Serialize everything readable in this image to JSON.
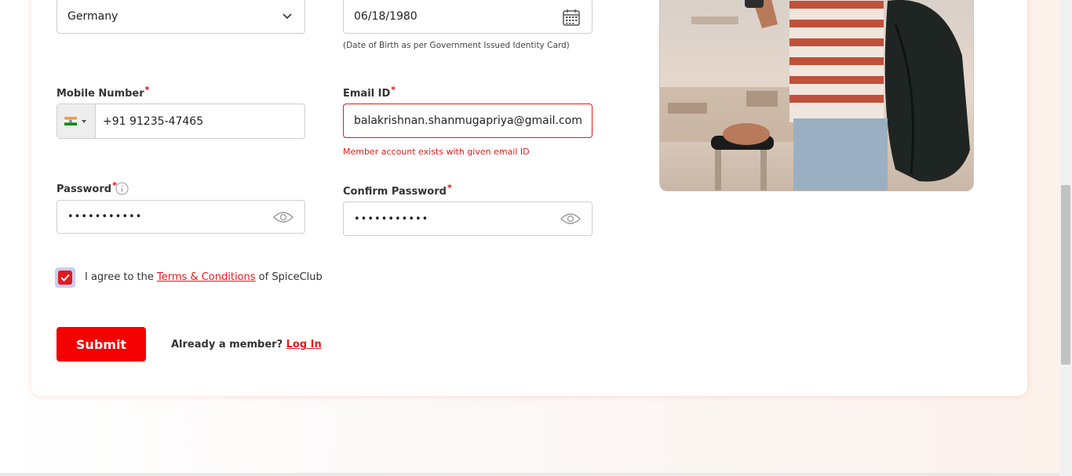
{
  "form": {
    "country": {
      "value": "Germany"
    },
    "dob": {
      "value": "06/18/1980",
      "helper": "(Date of Birth as per Government Issued Identity Card)"
    },
    "mobile": {
      "label": "Mobile Number",
      "required_mark": "*",
      "country_code_flag": "india-flag-icon",
      "value": "+91 91235-47465"
    },
    "email": {
      "label": "Email ID",
      "required_mark": "*",
      "value": "balakrishnan.shanmugapriya@gmail.com",
      "error": "Member account exists with given email ID"
    },
    "password": {
      "label": "Password",
      "required_mark": "*",
      "value": "•••••••••••"
    },
    "confirm_password": {
      "label": "Confirm Password",
      "required_mark": "*",
      "value": "•••••••••••"
    },
    "terms": {
      "checked": true,
      "prefix": "I agree to the ",
      "link": "Terms & Conditions",
      "suffix": " of SpiceClub"
    },
    "submit_label": "Submit",
    "member": {
      "prefix": "Already a member? ",
      "link": "Log In"
    }
  },
  "colors": {
    "accent": "#f40000",
    "error": "#e11b1b"
  }
}
